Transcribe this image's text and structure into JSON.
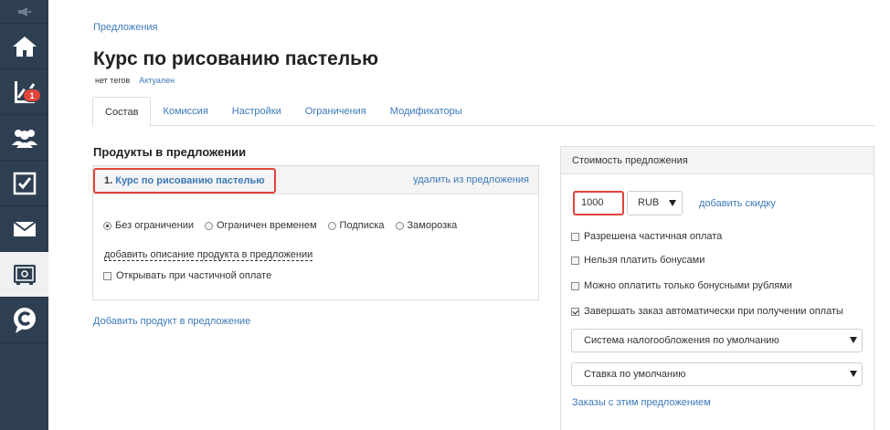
{
  "sidebar": {
    "items": [
      {
        "name": "home",
        "icon": "home-icon"
      },
      {
        "name": "stats",
        "icon": "chart-icon",
        "badge": "1"
      },
      {
        "name": "users",
        "icon": "users-icon"
      },
      {
        "name": "tasks",
        "icon": "checkbox-icon"
      },
      {
        "name": "mail",
        "icon": "mail-icon"
      },
      {
        "name": "store",
        "icon": "safe-icon",
        "active": true
      },
      {
        "name": "chat",
        "icon": "chat-c-icon"
      }
    ],
    "accent": "#2f3f52",
    "badge_color": "#e0443b"
  },
  "breadcrumb": "Предложения",
  "page": {
    "title": "Курс по рисованию пастелью",
    "tags": "нет тегов",
    "status": "Актуален"
  },
  "tabs": [
    {
      "label": "Состав",
      "active": true
    },
    {
      "label": "Комиссия"
    },
    {
      "label": "Настройки"
    },
    {
      "label": "Ограничения"
    },
    {
      "label": "Модификаторы"
    }
  ],
  "products": {
    "section_title": "Продукты в предложении",
    "item": {
      "number": "1.",
      "name": "Курс по рисованию пастелью",
      "remove_label": "удалить из предложения",
      "radios": [
        {
          "label": "Без ограничении",
          "selected": true
        },
        {
          "label": "Ограничен временем",
          "selected": false
        },
        {
          "label": "Подписка",
          "selected": false
        },
        {
          "label": "Заморозка",
          "selected": false
        }
      ],
      "add_description": "добавить описание продукта в предложении",
      "partial_open_label": "Открывать при частичной оплате",
      "partial_open_checked": false
    },
    "add_product": "Добавить продукт в предложение"
  },
  "price": {
    "title": "Стоимость предложения",
    "amount": "1000",
    "currency": "RUB",
    "add_discount": "добавить скидку",
    "options": [
      {
        "label": "Разрешена частичная оплата",
        "checked": false
      },
      {
        "label": "Нельзя платить бонусами",
        "checked": false
      },
      {
        "label": "Можно оплатить только бонусными рублями",
        "checked": false
      },
      {
        "label": "Завершать заказ автоматически при получении оплаты",
        "checked": true
      }
    ],
    "tax_system": "Система налогообложения по умолчанию",
    "tax_rate": "Ставка по умолчанию",
    "orders_link": "Заказы с этим предложением"
  }
}
